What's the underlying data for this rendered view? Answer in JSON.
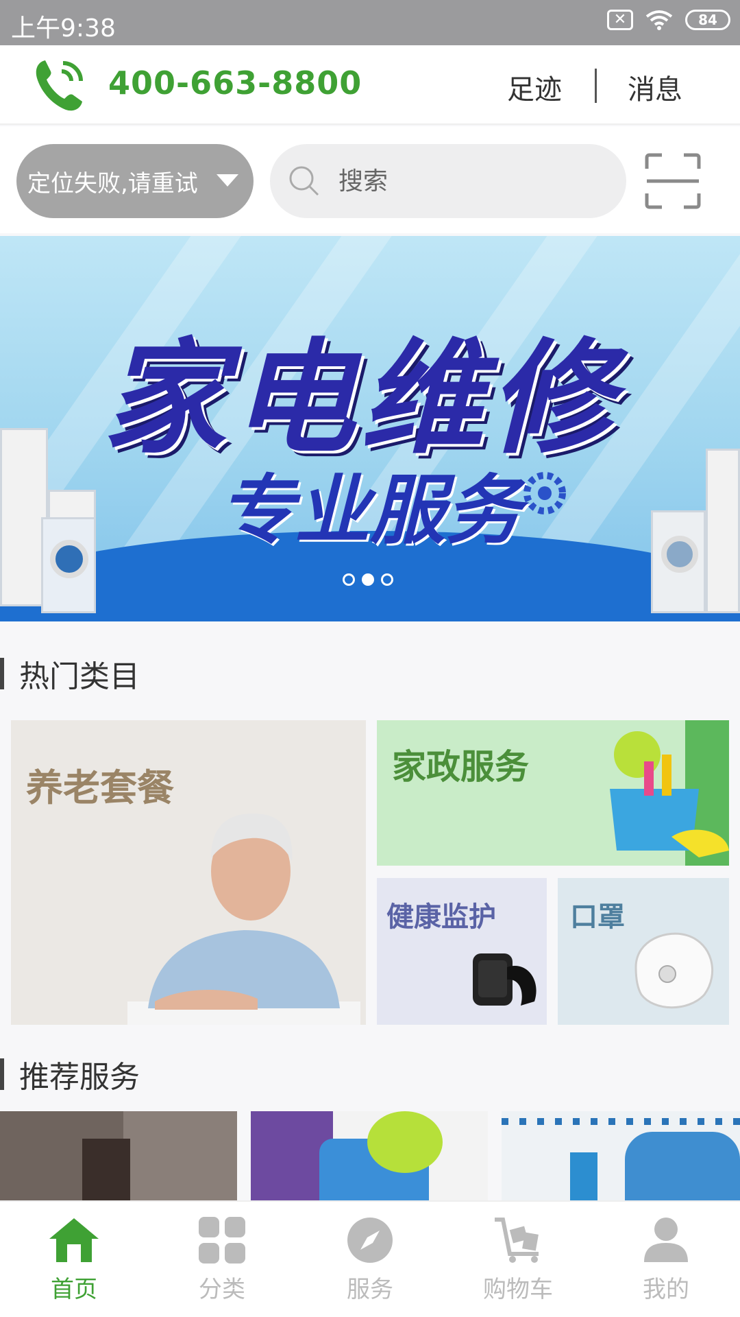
{
  "status_bar": {
    "time": "上午9:38",
    "battery": "84"
  },
  "header": {
    "phone": "400-663-8800",
    "footprints": "足迹",
    "messages": "消息"
  },
  "search_row": {
    "location": "定位失败,请重试",
    "search_placeholder": "搜索"
  },
  "banner": {
    "title": "家电维修",
    "subtitle": "专业服务",
    "slides": 3,
    "active_slide": 2
  },
  "hot_section": {
    "title": "热门类目",
    "tiles": [
      "养老套餐",
      "家政服务",
      "健康监护",
      "口罩"
    ]
  },
  "recommend_section": {
    "title": "推荐服务"
  },
  "bottom_nav": {
    "items": [
      "首页",
      "分类",
      "服务",
      "购物车",
      "我的"
    ],
    "active": "首页"
  },
  "colors": {
    "accent": "#3fa134",
    "inactive": "#bbbbbb"
  }
}
